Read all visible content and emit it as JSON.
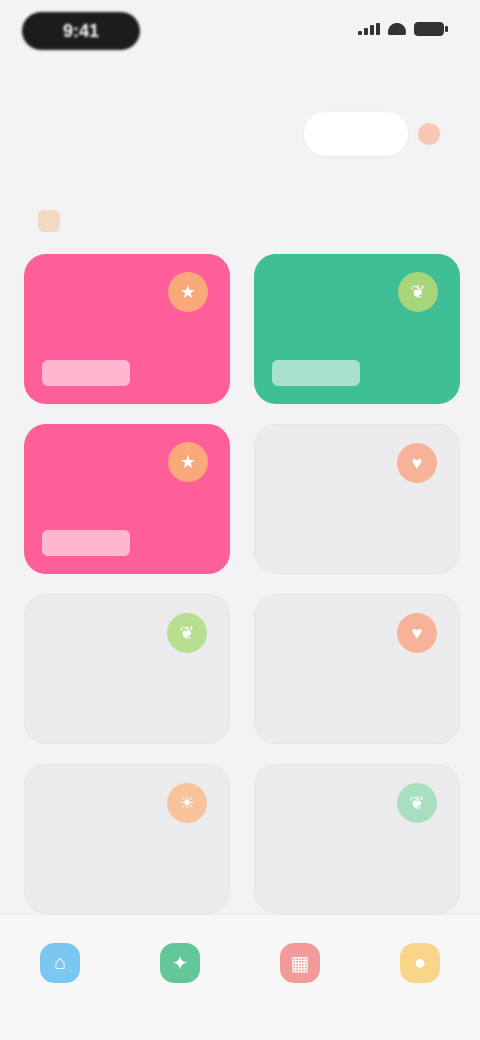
{
  "status_bar": {
    "time": "9:41"
  },
  "header": {
    "hint": "",
    "pill_button": "",
    "accent": "#f7c9b2"
  },
  "section": {
    "title": ""
  },
  "cards": [
    {
      "id": "card-1",
      "label": "",
      "bg": "#ff5f98",
      "icon_bg": "#f9a97a",
      "icon": "star-icon",
      "glyph": "★",
      "filled": true
    },
    {
      "id": "card-2",
      "label": "",
      "bg": "#3fbf95",
      "icon_bg": "#a8d47a",
      "icon": "leaf-icon",
      "glyph": "❦",
      "filled": true
    },
    {
      "id": "card-3",
      "label": "",
      "bg": "#ff5f98",
      "icon_bg": "#f9a97a",
      "icon": "star-icon",
      "glyph": "★",
      "filled": true
    },
    {
      "id": "card-4",
      "label": "",
      "bg": "#ebebee",
      "icon_bg": "#f7b39a",
      "icon": "heart-icon",
      "glyph": "♥",
      "filled": false
    },
    {
      "id": "card-5",
      "label": "",
      "bg": "#ebebee",
      "icon_bg": "#b7df8f",
      "icon": "leaf-icon",
      "glyph": "❦",
      "filled": false
    },
    {
      "id": "card-6",
      "label": "",
      "bg": "#ebebee",
      "icon_bg": "#f7b39a",
      "icon": "heart-icon",
      "glyph": "♥",
      "filled": false
    },
    {
      "id": "card-7",
      "label": "",
      "bg": "#ebebee",
      "icon_bg": "#f6c39a",
      "icon": "sun-icon",
      "glyph": "☀",
      "filled": false
    },
    {
      "id": "card-8",
      "label": "",
      "bg": "#ebebee",
      "icon_bg": "#a9dfbe",
      "icon": "leaf-icon",
      "glyph": "❦",
      "filled": false
    }
  ],
  "tabbar": [
    {
      "id": "home",
      "label": "",
      "color": "#7cc6f2",
      "icon": "home-icon",
      "glyph": "⌂"
    },
    {
      "id": "explore",
      "label": "",
      "color": "#63c799",
      "icon": "compass-icon",
      "glyph": "✦"
    },
    {
      "id": "stats",
      "label": "",
      "color": "#f39a9a",
      "icon": "chart-icon",
      "glyph": "▦"
    },
    {
      "id": "profile",
      "label": "",
      "color": "#f9d58a",
      "icon": "user-icon",
      "glyph": "●"
    }
  ]
}
